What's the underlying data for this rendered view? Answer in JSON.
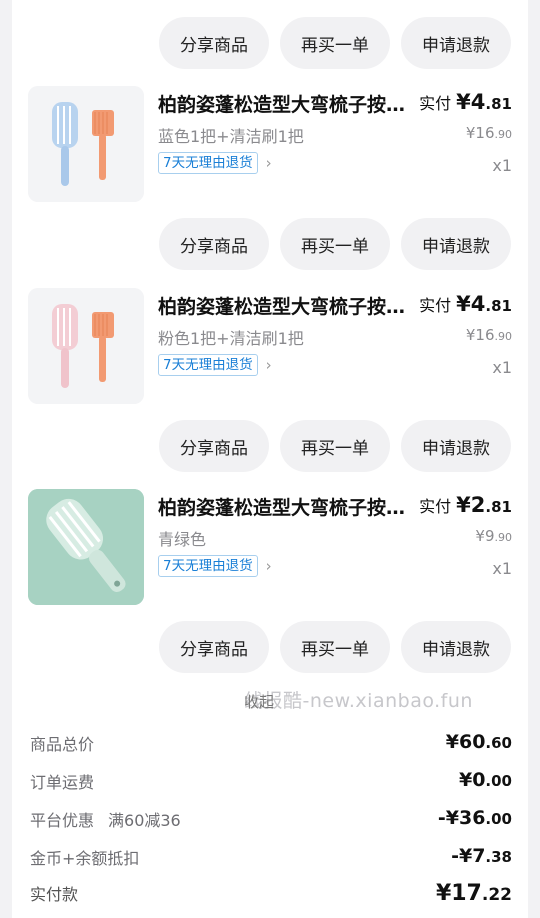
{
  "actions": {
    "share": "分享商品",
    "rebuy": "再买一单",
    "refund": "申请退款"
  },
  "items": [
    {
      "title": "柏韵姿蓬松造型大弯梳子按摩梳",
      "variant": "蓝色1把+清洁刷1把",
      "tag": "7天无理由退货",
      "paid_label": "实付",
      "paid_currency": "¥",
      "paid_int": "4",
      "paid_dec": ".81",
      "orig_currency": "¥",
      "orig_int": "16",
      "orig_dec": ".90",
      "qty": "x1",
      "comb_color": "#a9c8ea"
    },
    {
      "title": "柏韵姿蓬松造型大弯梳子按摩梳",
      "variant": "粉色1把+清洁刷1把",
      "tag": "7天无理由退货",
      "paid_label": "实付",
      "paid_currency": "¥",
      "paid_int": "4",
      "paid_dec": ".81",
      "orig_currency": "¥",
      "orig_int": "16",
      "orig_dec": ".90",
      "qty": "x1",
      "comb_color": "#f0c3cb"
    },
    {
      "title": "柏韵姿蓬松造型大弯梳子按摩梳",
      "variant": "青绿色",
      "tag": "7天无理由退货",
      "paid_label": "实付",
      "paid_currency": "¥",
      "paid_int": "2",
      "paid_dec": ".81",
      "orig_currency": "¥",
      "orig_int": "9",
      "orig_dec": ".90",
      "qty": "x1",
      "comb_color": "#cfe6dc"
    }
  ],
  "watermark": "线报酷-new.xianbao.fun",
  "collapse_label": "收起",
  "summary": {
    "goods_total": {
      "label": "商品总价",
      "prefix": "¥",
      "int": "60",
      "dec": ".60"
    },
    "shipping": {
      "label": "订单运费",
      "prefix": "¥",
      "int": "0",
      "dec": ".00"
    },
    "platform_discount": {
      "label": "平台优惠",
      "sub": "满60减36",
      "prefix": "-¥",
      "int": "36",
      "dec": ".00"
    },
    "coins_balance": {
      "label": "金币+余额抵扣",
      "prefix": "-¥",
      "int": "7",
      "dec": ".38"
    },
    "paid_total": {
      "label": "实付款",
      "prefix": "¥",
      "int": "17",
      "dec": ".22"
    }
  },
  "colors": {
    "tag_blue": "#1a7fd6",
    "pill_bg": "#f1f1f3",
    "muted_text": "#8a8a8e"
  }
}
